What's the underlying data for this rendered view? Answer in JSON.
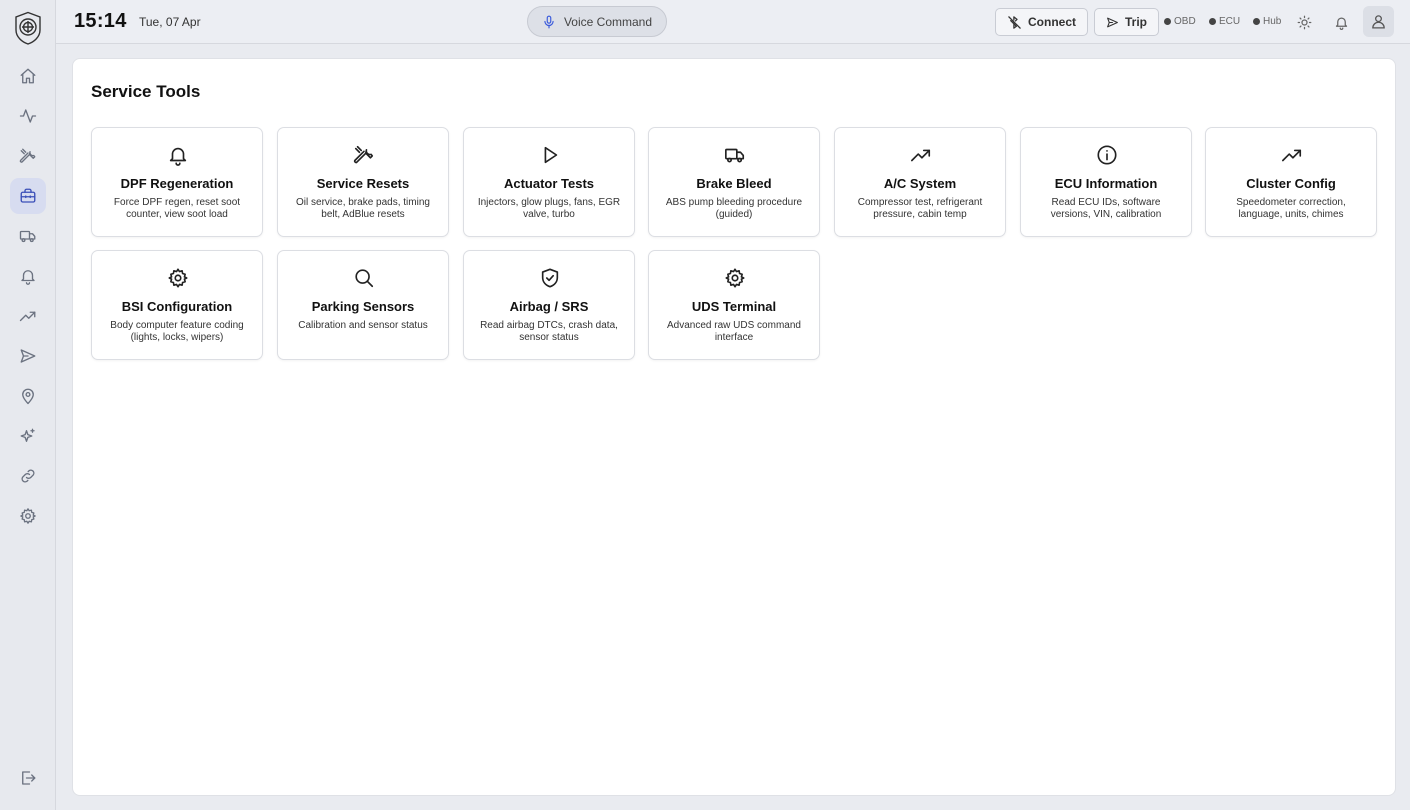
{
  "sidebar": {
    "items": [
      {
        "name": "home",
        "icon": "home-icon"
      },
      {
        "name": "live-data",
        "icon": "pulse-icon"
      },
      {
        "name": "diagnostics",
        "icon": "tools-icon"
      },
      {
        "name": "service-tools",
        "icon": "toolbox-icon",
        "active": true
      },
      {
        "name": "vehicle",
        "icon": "truck-icon"
      },
      {
        "name": "alerts",
        "icon": "bell-icon"
      },
      {
        "name": "trends",
        "icon": "trending-up-icon"
      },
      {
        "name": "trips",
        "icon": "send-icon"
      },
      {
        "name": "location",
        "icon": "map-pin-icon"
      },
      {
        "name": "ai-assistant",
        "icon": "sparkles-icon"
      },
      {
        "name": "connections",
        "icon": "link-icon"
      },
      {
        "name": "settings",
        "icon": "gear-icon"
      }
    ],
    "logout_icon": "logout-icon"
  },
  "header": {
    "time": "15:14",
    "date": "Tue, 07 Apr",
    "voice_label": "Voice Command",
    "connect_label": "Connect",
    "trip_label": "Trip",
    "status": [
      "OBD",
      "ECU",
      "Hub"
    ]
  },
  "main": {
    "title": "Service Tools",
    "cards": [
      {
        "icon": "bell-icon",
        "title": "DPF Regeneration",
        "desc": "Force DPF regen, reset soot counter, view soot load"
      },
      {
        "icon": "wrench-icon",
        "title": "Service Resets",
        "desc": "Oil service, brake pads, timing belt, AdBlue resets"
      },
      {
        "icon": "play-icon",
        "title": "Actuator Tests",
        "desc": "Injectors, glow plugs, fans, EGR valve, turbo"
      },
      {
        "icon": "truck-icon",
        "title": "Brake Bleed",
        "desc": "ABS pump bleeding procedure (guided)"
      },
      {
        "icon": "trending-up-icon",
        "title": "A/C System",
        "desc": "Compressor test, refrigerant pressure, cabin temp"
      },
      {
        "icon": "info-icon",
        "title": "ECU Information",
        "desc": "Read ECU IDs, software versions, VIN, calibration"
      },
      {
        "icon": "trending-up-icon",
        "title": "Cluster Config",
        "desc": "Speedometer correction, language, units, chimes"
      },
      {
        "icon": "gear-icon",
        "title": "BSI Configuration",
        "desc": "Body computer feature coding (lights, locks, wipers)"
      },
      {
        "icon": "search-icon",
        "title": "Parking Sensors",
        "desc": "Calibration and sensor status"
      },
      {
        "icon": "shield-check-icon",
        "title": "Airbag / SRS",
        "desc": "Read airbag DTCs, crash data, sensor status"
      },
      {
        "icon": "gear-icon",
        "title": "UDS Terminal",
        "desc": "Advanced raw UDS command interface"
      }
    ]
  }
}
